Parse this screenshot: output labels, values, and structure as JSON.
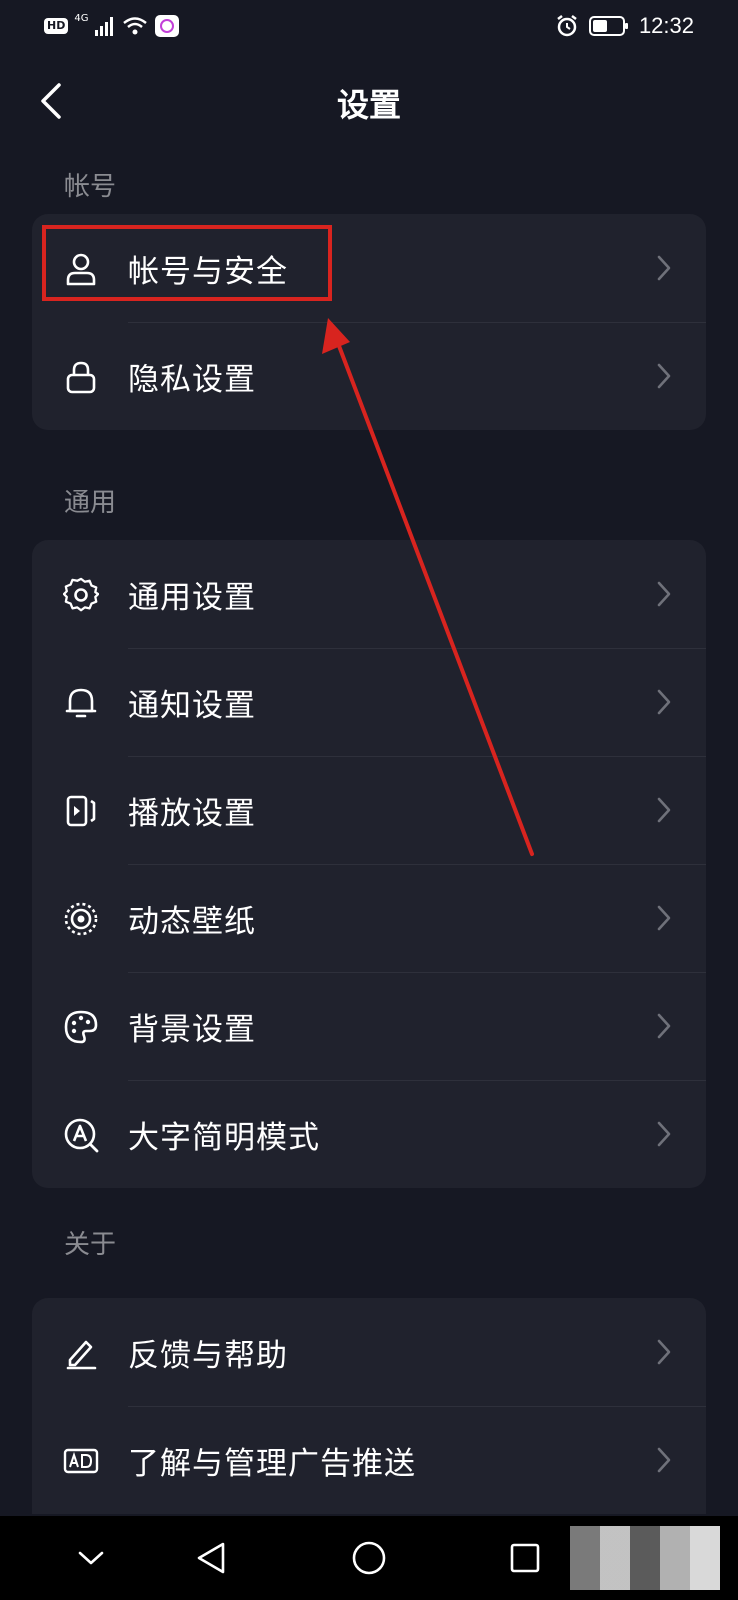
{
  "status_bar": {
    "hd": "HD",
    "network": "4G",
    "time": "12:32"
  },
  "header": {
    "title": "设置"
  },
  "sections": [
    {
      "label": "帐号",
      "items": [
        {
          "label": "帐号与安全",
          "icon": "person-icon"
        },
        {
          "label": "隐私设置",
          "icon": "lock-icon"
        }
      ]
    },
    {
      "label": "通用",
      "items": [
        {
          "label": "通用设置",
          "icon": "gear-icon"
        },
        {
          "label": "通知设置",
          "icon": "bell-icon"
        },
        {
          "label": "播放设置",
          "icon": "play-settings-icon"
        },
        {
          "label": "动态壁纸",
          "icon": "live-wallpaper-icon"
        },
        {
          "label": "背景设置",
          "icon": "palette-icon"
        },
        {
          "label": "大字简明模式",
          "icon": "large-font-icon"
        }
      ]
    },
    {
      "label": "关于",
      "items": [
        {
          "label": "反馈与帮助",
          "icon": "pencil-icon"
        },
        {
          "label": "了解与管理广告推送",
          "icon": "ad-icon"
        }
      ]
    }
  ],
  "colors": {
    "background": "#161823",
    "card": "#20222d",
    "annotation": "#d8241f"
  }
}
